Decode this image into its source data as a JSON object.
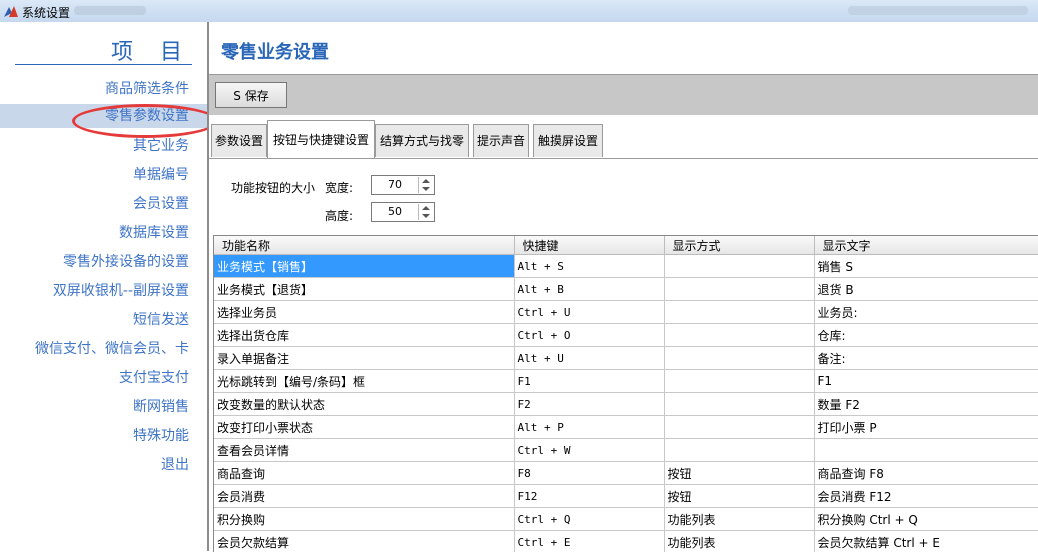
{
  "window": {
    "title": "系统设置"
  },
  "sidebar": {
    "heading": "项 目",
    "items": [
      "商品筛选条件",
      "零售参数设置",
      "其它业务",
      "单据编号",
      "会员设置",
      "数据库设置",
      "零售外接设备的设置",
      "双屏收银机--副屏设置",
      "短信发送",
      "微信支付、微信会员、卡",
      "支付宝支付",
      "断网销售",
      "特殊功能",
      "退出"
    ],
    "active_index": 1
  },
  "main": {
    "title": "零售业务设置",
    "save_label": "S 保存",
    "tabs": [
      "参数设置",
      "按钮与快捷键设置",
      "结算方式与找零",
      "提示声音",
      "触摸屏设置"
    ],
    "active_tab": 1,
    "button_size": {
      "label": "功能按钮的大小",
      "width_label": "宽度:",
      "width_value": "70",
      "height_label": "高度:",
      "height_value": "50"
    },
    "grid": {
      "columns": [
        "功能名称",
        "快捷键",
        "显示方式",
        "显示文字"
      ],
      "rows": [
        [
          "业务模式【销售】",
          "Alt + S",
          "",
          "销售 S"
        ],
        [
          "业务模式【退货】",
          "Alt + B",
          "",
          "退货 B"
        ],
        [
          "选择业务员",
          "Ctrl + U",
          "",
          "业务员:"
        ],
        [
          "选择出货仓库",
          "Ctrl + O",
          "",
          "仓库:"
        ],
        [
          "录入单据备注",
          "Alt + U",
          "",
          "备注:"
        ],
        [
          "光标跳转到【编号/条码】框",
          "F1",
          "",
          "F1"
        ],
        [
          "改变数量的默认状态",
          "F2",
          "",
          "数量 F2"
        ],
        [
          "改变打印小票状态",
          "Alt + P",
          "",
          "打印小票 P"
        ],
        [
          "查看会员详情",
          "Ctrl + W",
          "",
          ""
        ],
        [
          "商品查询",
          "F8",
          "按钮",
          "商品查询 F8"
        ],
        [
          "会员消费",
          "F12",
          "按钮",
          "会员消费 F12"
        ],
        [
          "积分换购",
          "Ctrl + Q",
          "功能列表",
          "积分换购 Ctrl + Q"
        ],
        [
          "会员欠款结算",
          "Ctrl + E",
          "功能列表",
          "会员欠款结算 Ctrl + E"
        ]
      ],
      "selected_row": 0
    }
  }
}
